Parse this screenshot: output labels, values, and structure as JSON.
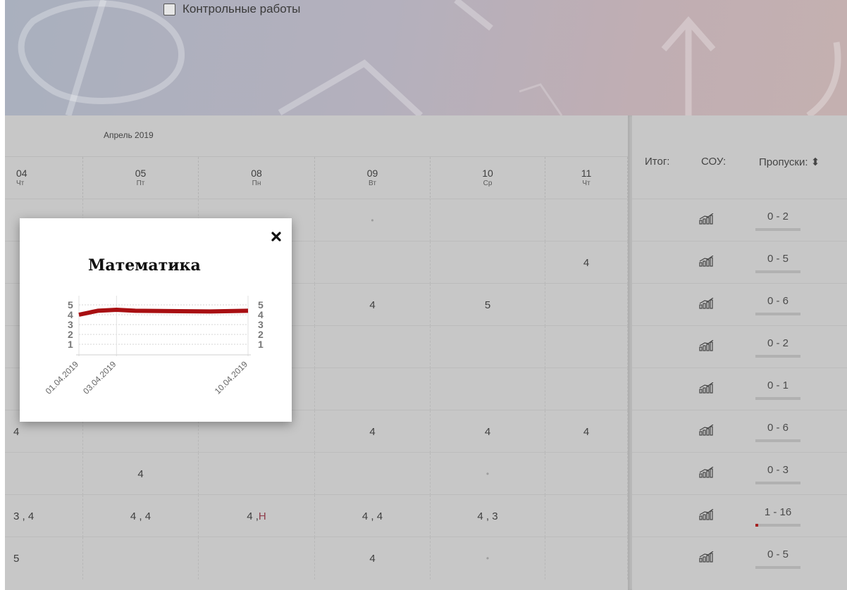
{
  "filters": {
    "control_works_label": "Контрольные работы"
  },
  "grades": {
    "month": "Апрель 2019",
    "days": [
      {
        "num": "04",
        "dow": "Чт"
      },
      {
        "num": "05",
        "dow": "Пт"
      },
      {
        "num": "08",
        "dow": "Пн"
      },
      {
        "num": "09",
        "dow": "Вт"
      },
      {
        "num": "10",
        "dow": "Ср"
      },
      {
        "num": "11",
        "dow": "Чт"
      }
    ],
    "rows": [
      [
        "",
        "",
        "",
        "•",
        "",
        ""
      ],
      [
        "",
        "",
        "",
        "",
        "",
        "4"
      ],
      [
        "",
        "",
        "",
        "4",
        "5",
        ""
      ],
      [
        "",
        "",
        "",
        "",
        "",
        ""
      ],
      [
        "",
        "",
        "",
        "",
        "",
        ""
      ],
      [
        "4",
        "",
        "",
        "4",
        "4",
        "4"
      ],
      [
        "",
        "4",
        "",
        "",
        "•",
        ""
      ],
      [
        "3 , 4",
        "4 , 4",
        "4 , ",
        "4 , 4",
        "4 , 3",
        ""
      ],
      [
        "5",
        "",
        "",
        "4",
        "•",
        ""
      ]
    ],
    "absent_mark": "Н"
  },
  "summary": {
    "headers": {
      "total": "Итог:",
      "sou": "СОУ:",
      "absences": "Пропуски:"
    },
    "absences": [
      {
        "text": "0 - 2",
        "fraction": 0
      },
      {
        "text": "0 - 5",
        "fraction": 0
      },
      {
        "text": "0 - 6",
        "fraction": 0
      },
      {
        "text": "0 - 2",
        "fraction": 0
      },
      {
        "text": "0 - 1",
        "fraction": 0
      },
      {
        "text": "0 - 6",
        "fraction": 0
      },
      {
        "text": "0 - 3",
        "fraction": 0
      },
      {
        "text": "1 - 16",
        "fraction": 0.0625
      },
      {
        "text": "0 - 5",
        "fraction": 0
      }
    ]
  },
  "popup": {
    "title": "Математика",
    "close_icon": "close-x-icon",
    "line_color": "#a80f12"
  },
  "chart_data": {
    "type": "line",
    "title": "Математика",
    "x_tick_labels": [
      "01.04.2019",
      "03.04.2019",
      "10.04.2019"
    ],
    "y_ticks": [
      1,
      2,
      3,
      4,
      5
    ],
    "ylim": [
      1,
      5
    ],
    "series": [
      {
        "x": [
          "01.04.2019",
          "02.04.2019",
          "03.04.2019",
          "04.04.2019",
          "08.04.2019",
          "10.04.2019"
        ],
        "values": [
          4.0,
          4.4,
          4.5,
          4.4,
          4.33,
          4.4
        ]
      }
    ]
  }
}
